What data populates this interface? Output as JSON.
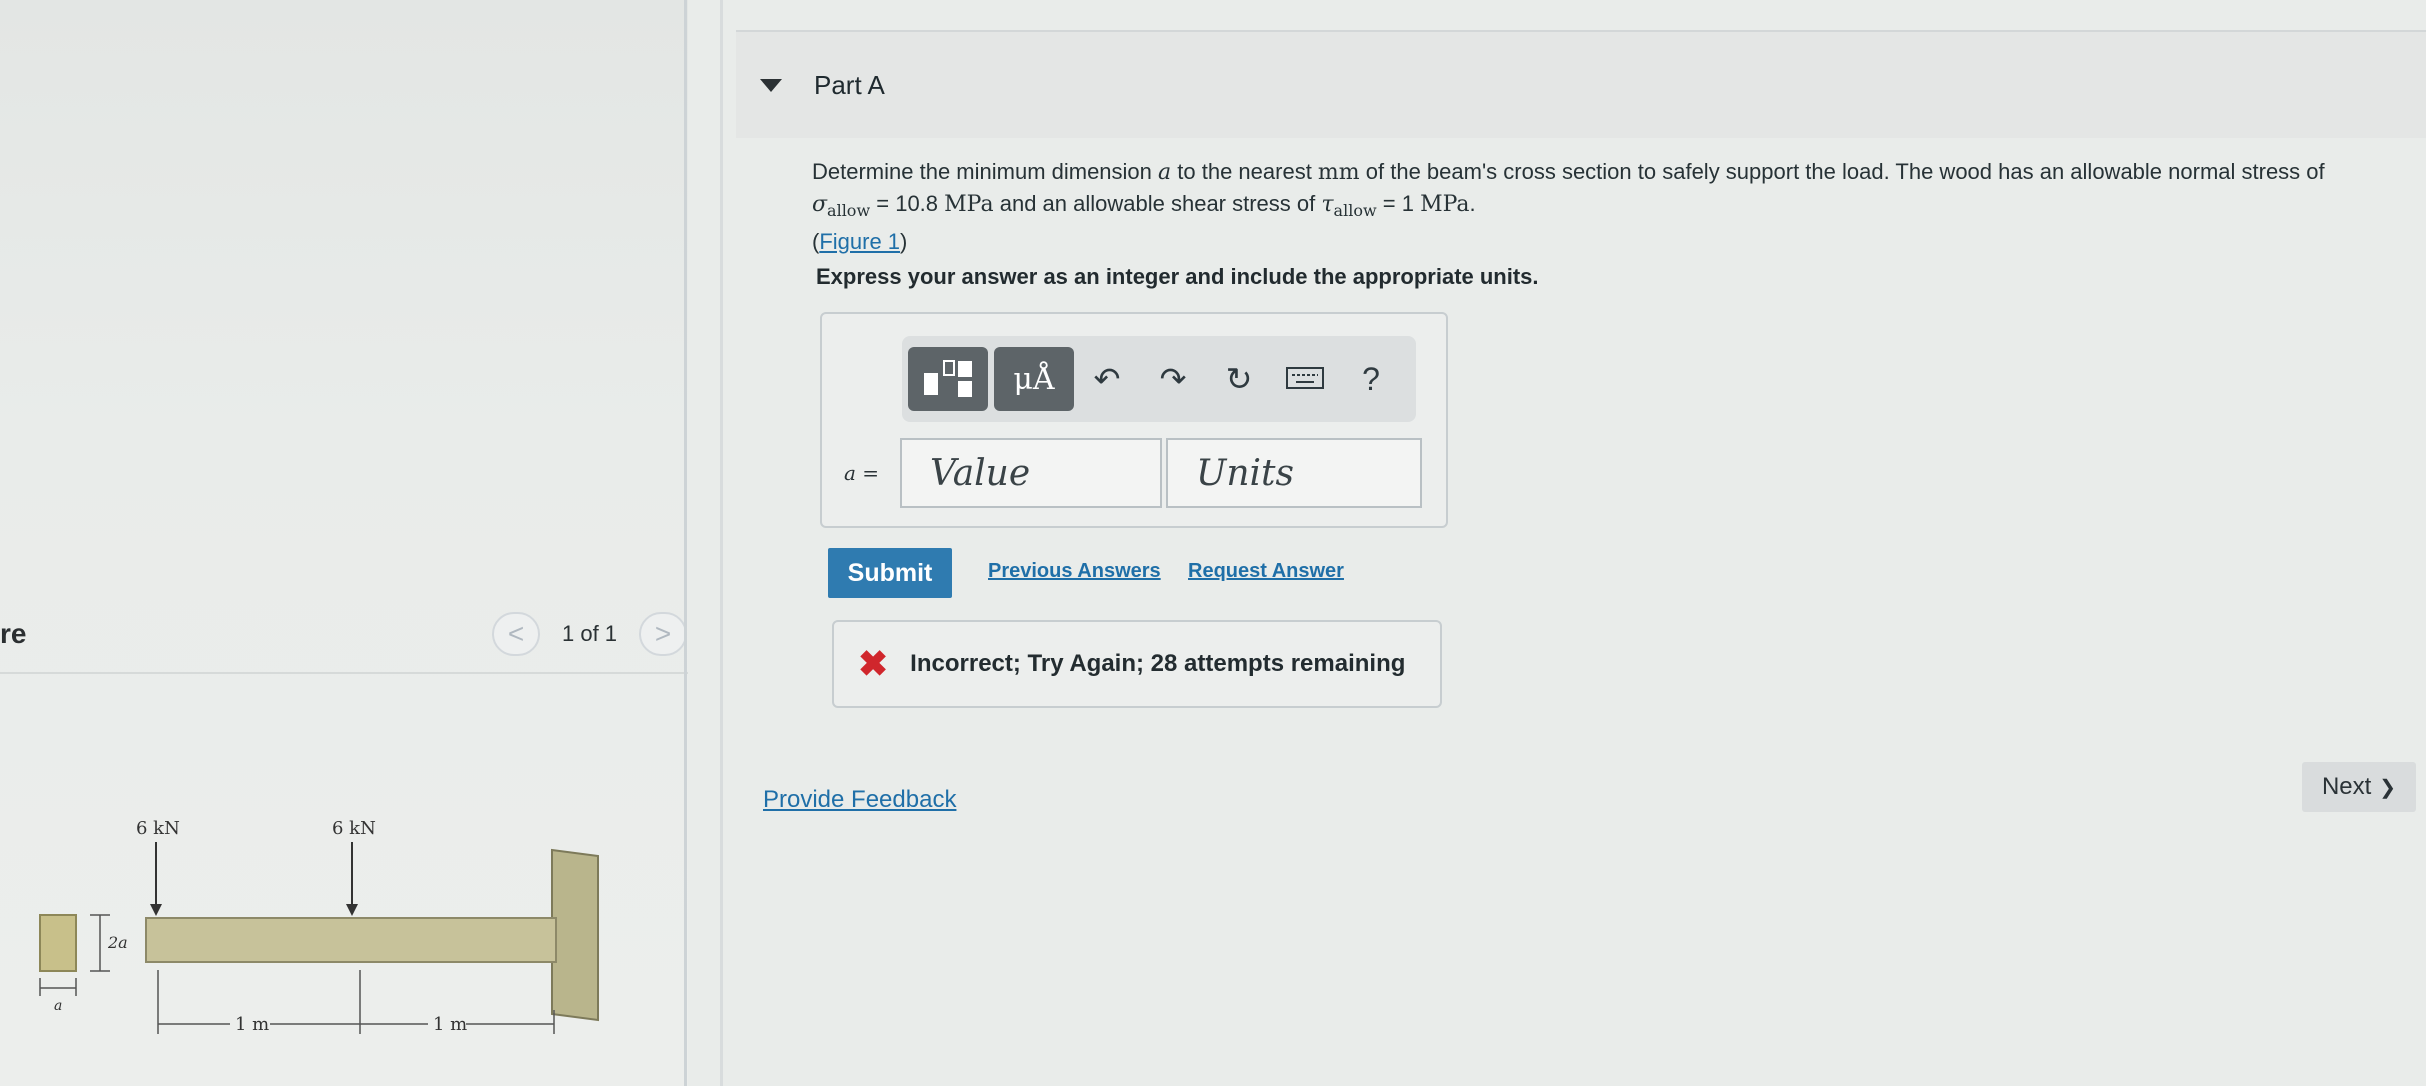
{
  "figure_panel": {
    "label": "re",
    "pager": {
      "prev": "<",
      "text": "1 of 1",
      "next": ">"
    },
    "figure": {
      "load_left": "6 kN",
      "load_right": "6 kN",
      "height_label": "2a",
      "width_label": "a",
      "span_left": "1 m",
      "span_right": "1 m"
    }
  },
  "part": {
    "title": "Part A"
  },
  "problem": {
    "t1": "Determine the minimum dimension ",
    "var_a": "a",
    "t2": " to the nearest ",
    "unit_mm": "mm",
    "t3": " of the beam's cross section to safely support the load. The wood has an allowable normal stress of",
    "sigma": "σ",
    "allow": "allow",
    "sigma_val": " = 10.8 ",
    "mpa": "MPa",
    "t4": " and an allowable shear stress of ",
    "tau": "τ",
    "tau_val": " = 1 ",
    "end": ".",
    "figure_link": "Figure 1"
  },
  "instruction": "Express your answer as an integer and include the appropriate units.",
  "answer": {
    "toolbar": {
      "units_label": "μÅ",
      "help": "?"
    },
    "var_label": "a =",
    "value_placeholder": "Value",
    "units_placeholder": "Units"
  },
  "actions": {
    "submit": "Submit",
    "previous_answers": "Previous Answers",
    "request_answer": "Request Answer"
  },
  "feedback": {
    "icon": "✖",
    "message": "Incorrect; Try Again; 28 attempts remaining"
  },
  "provide_feedback": "Provide Feedback",
  "next": {
    "label": "Next",
    "chevron": "❯"
  },
  "colors": {
    "accent": "#2f7bb0",
    "error": "#d0262c",
    "link": "#1f6fa8"
  }
}
